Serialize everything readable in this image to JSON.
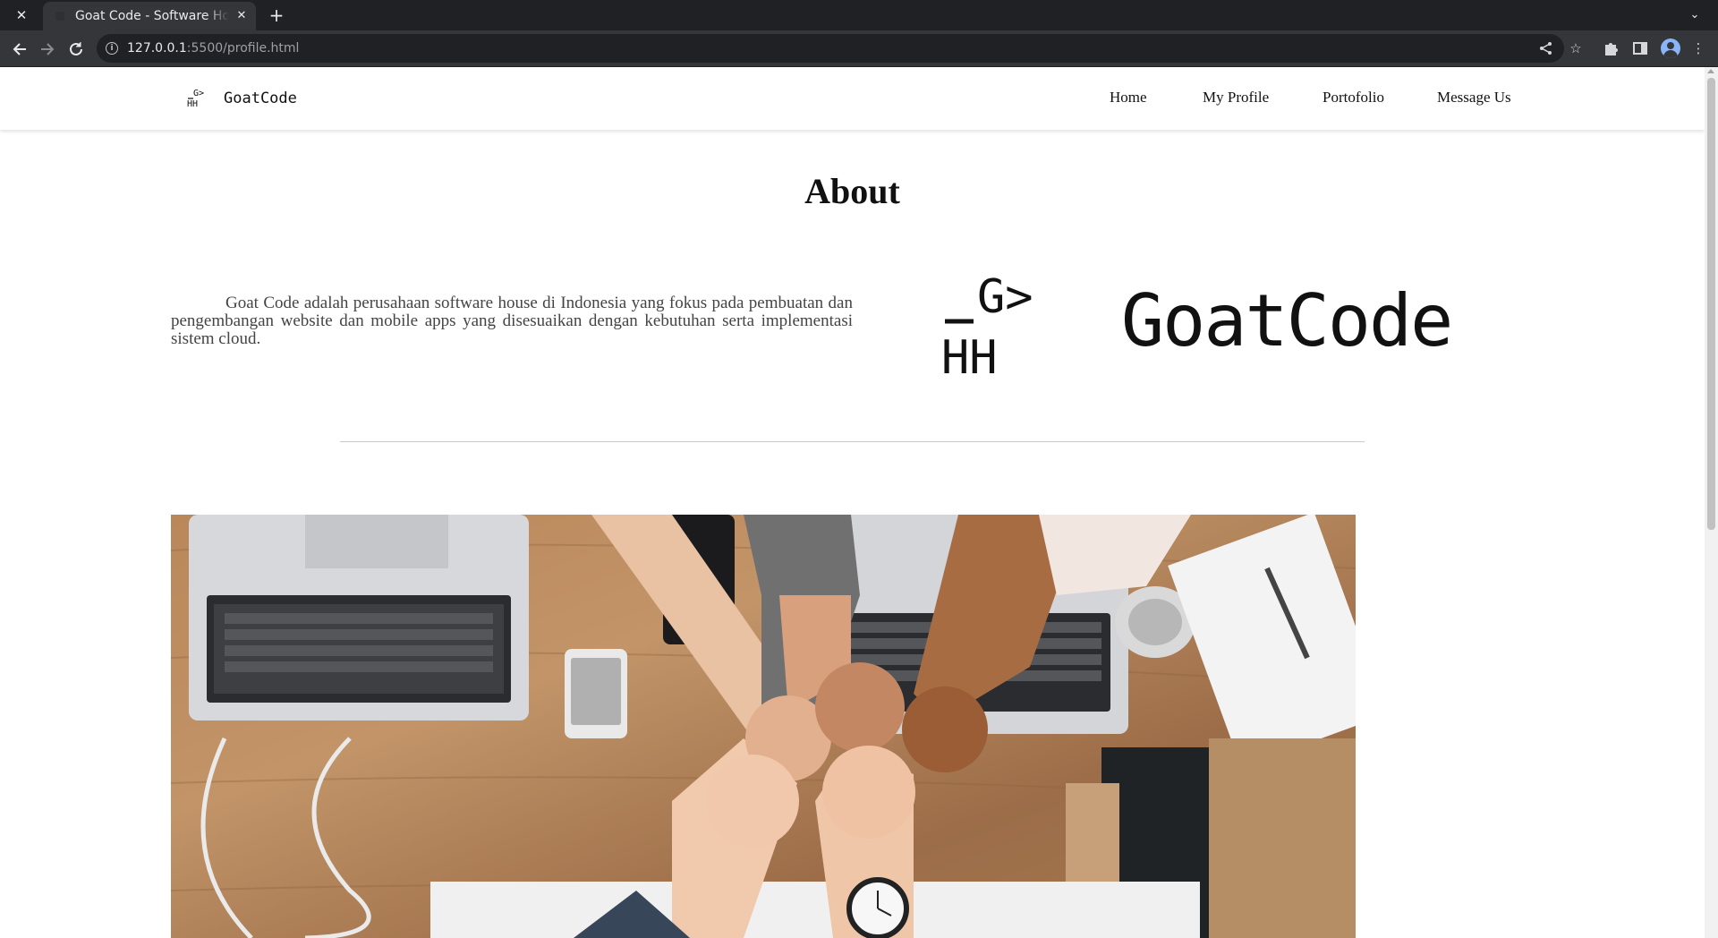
{
  "browser": {
    "tab_title": "Goat Code - Software House",
    "tab_close_glyph": "✕",
    "new_tab_glyph": "+",
    "url_host": "127.0.0.1",
    "url_rest": ":5500/profile.html",
    "icons": [
      "close-icon",
      "back-arrow-icon",
      "forward-arrow-icon",
      "reload-icon",
      "info-icon",
      "share-icon",
      "star-icon",
      "puzzle-icon",
      "side-panel-icon",
      "avatar-icon",
      "kebab-menu-icon",
      "chevron-down-icon"
    ]
  },
  "nav": {
    "brand_mark_top": "G>",
    "brand_mark_bottom": "HH",
    "brand_name": "GoatCode",
    "links": [
      "Home",
      "My Profile",
      "Portofolio",
      "Message Us"
    ]
  },
  "about": {
    "title": "About",
    "text": "Goat Code adalah perusahaan software house di Indonesia yang fokus pada pembuatan dan pengembangan website dan mobile apps yang disesuaikan dengan kebutuhan serta implementasi sistem cloud.",
    "logo_mark_top": "G>",
    "logo_mark_bottom": "HH",
    "logo_name": "GoatCode"
  },
  "colors": {
    "chrome_dark": "#202124",
    "chrome_tab": "#35363a",
    "text": "#111111",
    "paragraph": "#444444"
  }
}
